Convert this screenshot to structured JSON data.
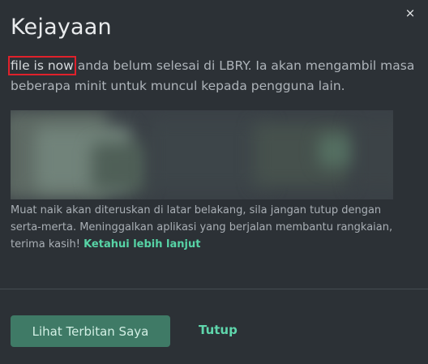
{
  "dialog": {
    "title": "Kejayaan",
    "close_icon": "×",
    "highlighted_text": "file is now",
    "description_rest": " anda belum selesai di LBRY. Ia akan mengambil masa beberapa minit untuk muncul kepada pengguna lain.",
    "note_text": "Muat naik akan diteruskan di latar belakang, sila jangan tutup dengan serta-merta. Meninggalkan aplikasi yang berjalan membantu rangkaian, terima kasih! ",
    "learn_more_link": "Ketahui lebih lanjut",
    "primary_button": "Lihat Terbitan Saya",
    "secondary_button": "Tutup"
  },
  "colors": {
    "background": "#2c3136",
    "accent": "#5fd6ac",
    "primary_button": "#3f7a66",
    "highlight_box": "#e0212b"
  }
}
